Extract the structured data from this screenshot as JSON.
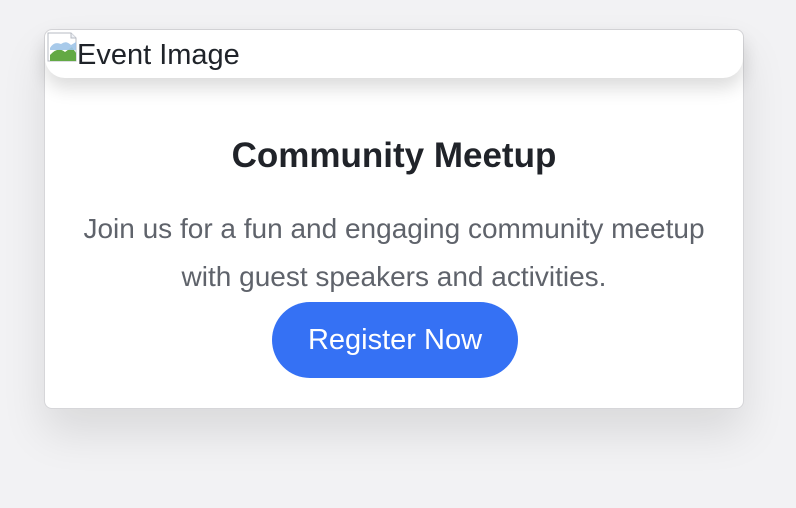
{
  "event_card": {
    "image": {
      "alt_text": "Event Image",
      "icon": "broken-image-icon"
    },
    "title": "Community Meetup",
    "description": "Join us for a fun and engaging community meetup with guest speakers and activities.",
    "register_button": {
      "label": "Register Now"
    }
  },
  "colors": {
    "button_background": "#3571f4",
    "title_text": "#202329",
    "body_text": "#5f636b",
    "page_background": "#f2f2f4"
  }
}
